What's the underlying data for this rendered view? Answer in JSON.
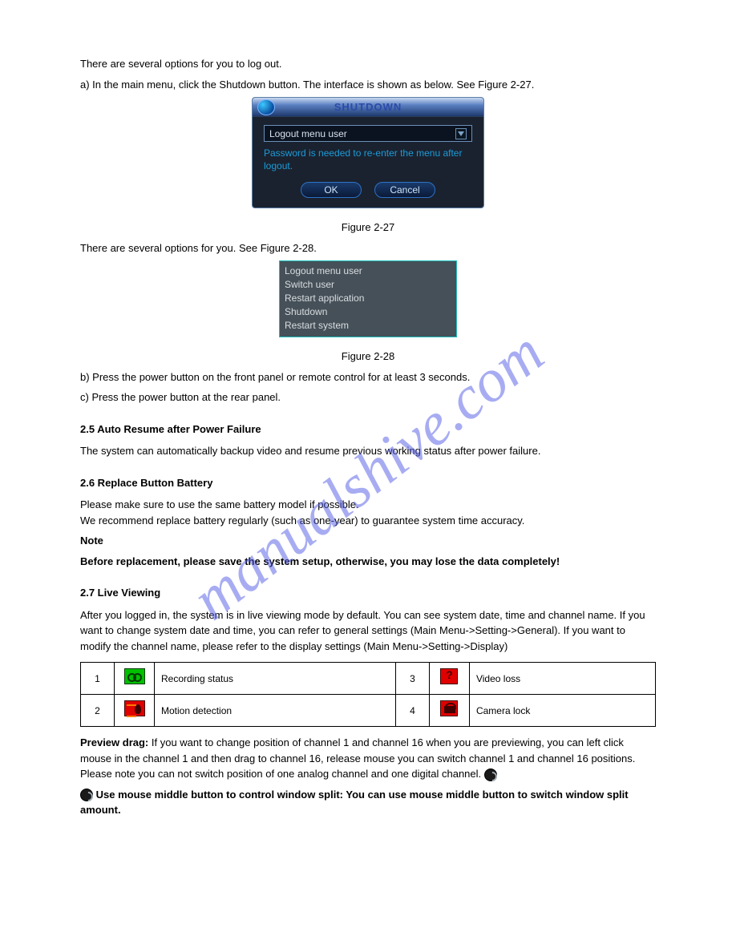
{
  "watermark": "manualshive.com",
  "intro": "There are several options for you to log out.",
  "via_menu": "a) In the main menu, click the Shutdown button. The interface is shown as below. See Figure 2-27.",
  "shutdown_dialog": {
    "title": "SHUTDOWN",
    "select_value": "Logout menu user",
    "message": "Password is needed to re-enter the menu after logout.",
    "ok": "OK",
    "cancel": "Cancel"
  },
  "fig_27": "Figure 2-27",
  "options_intro": "There are several options for you. See Figure 2-28.",
  "options": {
    "o1": "Logout menu user",
    "o2": "Switch user",
    "o3": "Restart application",
    "o4": "Shutdown",
    "o5": "Restart system"
  },
  "fig_28": "Figure 2-28",
  "via_front": "b) Press the power button on the front panel or remote control for at least 3 seconds.",
  "via_rear": "c) Press the power button at the rear panel.",
  "section_resume": "2.5 Auto Resume after Power Failure",
  "resume_body": "The system can automatically backup video and resume previous working status after power failure.",
  "section_battery": "2.6 Replace Button Battery",
  "battery_body": "Please make sure to use the same battery model if possible.\nWe recommend replace battery regularly (such as one-year) to guarantee system time accuracy.",
  "battery_note_label": "Note",
  "battery_note": "Before replacement, please save the system setup, otherwise, you may lose the data completely!",
  "section_live": "2.7 Live Viewing",
  "live_intro": "After you logged in, the system is in live viewing mode by default. You can see system date, time and channel name. If you want to change system date and time, you can refer to general settings (Main Menu->Setting->General). If you want to modify the channel name, please refer to the display settings (Main Menu->Setting->Display)",
  "table": {
    "r1n": "1",
    "r1d": "Recording status",
    "r3n": "3",
    "r3d": "Video loss",
    "r2n": "2",
    "r2d": "Motion detection",
    "r4n": "4",
    "r4d": "Camera lock"
  },
  "preview_drag_1": "Preview drag: If you want to change position of channel 1 and channel 16 when you are previewing, you can left click mouse in the channel 1 and then drag to channel 16, release mouse you can switch channel 1 and channel 16 positions.",
  "preview_audio_1": "Use mouse middle button to control window split: You can use mouse middle button to switch window split amount.",
  "preview_audio_2_before": "Please note you can not switch position of one analog channel and one digital channel.",
  "preview_audio_prefix": "Preview drag:",
  "audio_line_prefix_a": "Preview drag:",
  "audio_line_a": "If you want to change position of channel 1 and channel 16 when you are previewing, you can left click mouse in the channel 1 and then drag to channel 16, release mouse you can switch channel 1 and channel 16 positions.",
  "audio_line_b": "Use mouse middle button to control window split: You can use mouse middle button to switch window split amount."
}
